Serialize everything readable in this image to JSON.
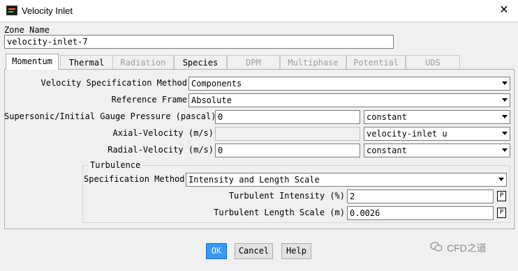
{
  "window": {
    "title": "Velocity Inlet",
    "close_glyph": "✕"
  },
  "zone": {
    "label": "Zone Name",
    "value": "velocity-inlet-7"
  },
  "tabs": [
    {
      "label": "Momentum",
      "state": "active"
    },
    {
      "label": "Thermal",
      "state": "enabled"
    },
    {
      "label": "Radiation",
      "state": "disabled"
    },
    {
      "label": "Species",
      "state": "enabled"
    },
    {
      "label": "DPM",
      "state": "disabled"
    },
    {
      "label": "Multiphase",
      "state": "disabled"
    },
    {
      "label": "Potential",
      "state": "disabled"
    },
    {
      "label": "UDS",
      "state": "disabled"
    }
  ],
  "momentum": {
    "velocity_spec_method": {
      "label": "Velocity Specification Method",
      "value": "Components"
    },
    "reference_frame": {
      "label": "Reference Frame",
      "value": "Absolute"
    },
    "gauge_pressure": {
      "label": "Supersonic/Initial Gauge Pressure (pascal)",
      "value": "0",
      "option": "constant"
    },
    "axial_velocity": {
      "label": "Axial-Velocity (m/s)",
      "value": "",
      "option": "velocity-inlet u"
    },
    "radial_velocity": {
      "label": "Radial-Velocity (m/s)",
      "value": "0",
      "option": "constant"
    }
  },
  "turbulence": {
    "title": "Turbulence",
    "spec_method": {
      "label": "Specification Method",
      "value": "Intensity and Length Scale"
    },
    "intensity": {
      "label": "Turbulent Intensity (%)",
      "value": "2",
      "param": "P"
    },
    "length_scale": {
      "label": "Turbulent Length Scale (m)",
      "value": "0.0026",
      "param": "P"
    }
  },
  "buttons": {
    "ok": "OK",
    "cancel": "Cancel",
    "help": "Help"
  },
  "watermark": {
    "text": "CFD之道",
    "icon": "wechat-icon"
  },
  "colors": {
    "accent": "#3399ff",
    "panel": "#f0f0f0"
  }
}
